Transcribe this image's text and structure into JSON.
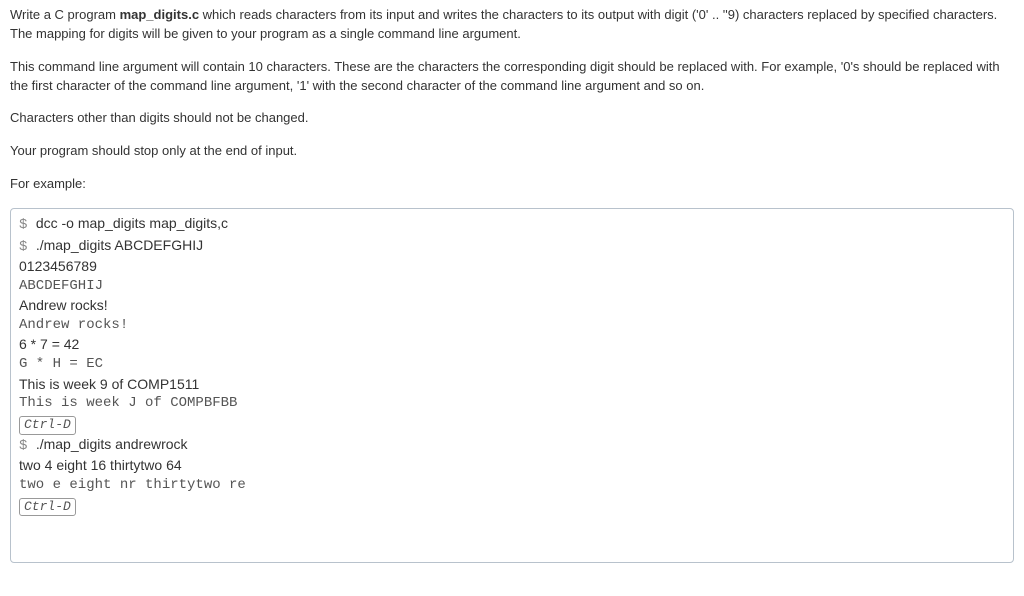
{
  "instructions": {
    "p1_pre": "Write a C program ",
    "p1_prog": "map_digits.c",
    "p1_post": " which reads characters from its input and writes the characters to its output with digit ('0' .. ''9) characters replaced by specified characters.",
    "p2": "The mapping for digits will be given to your program as a single command line argument.",
    "p3": "This command line argument will contain 10 characters. These are the characters the corresponding digit should be replaced with. For example, '0's should be replaced with the first character of the command line argument, '1' with the second character of the command line argument and so on.",
    "p4": "Characters other than digits should not be changed.",
    "p5": "Your program should stop only at the end of input.",
    "p6": "For example:"
  },
  "prompt": "$ ",
  "term": {
    "l1": "dcc -o map_digits map_digits,c",
    "l2": "./map_digits ABCDEFGHIJ",
    "l3": "0123456789",
    "l4": "ABCDEFGHIJ",
    "l5": "Andrew rocks!",
    "l6": "Andrew rocks!",
    "l7": "6 * 7 = 42",
    "l8": "G * H = EC",
    "l9": "This is week 9 of COMP1511",
    "l10": "This is week J of COMPBFBB",
    "k1": "Ctrl-D",
    "l11": "./map_digits andrewrock",
    "l12": "two 4 eight 16 thirtytwo 64",
    "l13": "two e eight nr thirtytwo re",
    "k2": "Ctrl-D"
  }
}
